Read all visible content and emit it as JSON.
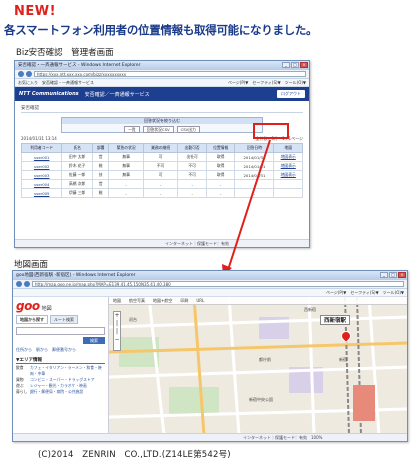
{
  "new_label": "NEW!",
  "headline": "各スマートフォン利用者の位置情報も取得可能になりました。",
  "caption_admin": "Biz安否確認　管理者画面",
  "caption_map": "地図画面",
  "footer": "(C)2014　ZENRIN　CO.,LTD.(Z14LE第542号)",
  "colors": {
    "new": "#e0201a",
    "headline": "#1a3a8a",
    "header_blue": "#1d3f8f",
    "highlight": "#e0201a"
  },
  "admin_window": {
    "title": "安否確認・一斉通報サービス - Windows Internet Explorer",
    "url": "https://xxx.ntt.xxx.xxx.com/bizz/xxxxxxxxxx",
    "toolbar_left": "お気に入り　安否確認・一斉通報サービス",
    "toolbar_right": "ページ(P)▼　セーフティ(S)▼　ツール(O)▼",
    "logo": "NTT Communications",
    "app_title": "安否確認／一斉通報サービス",
    "logout": "ログアウト",
    "section": "安否確認",
    "filter_header": "回答状況を絞り込む",
    "filter_buttons": [
      "一覧",
      "回答状況CSV",
      "CSV出力"
    ],
    "meta_left": "2014/01/31 13:14",
    "meta_right": "全件数：5件　1 / 1ページ",
    "columns": [
      "利用者コード",
      "氏名",
      "部署",
      "緊急の状況",
      "業務の継続",
      "出勤可否",
      "位置情報",
      "回答日時",
      "地図"
    ],
    "rows": [
      [
        "user001",
        "田中 太郎",
        "営",
        "無事",
        "可",
        "出社可",
        "取得",
        "2014/01/31",
        "地図表示"
      ],
      [
        "user002",
        "鈴木 花子",
        "総",
        "無事",
        "不可",
        "不可",
        "取得",
        "2014/01/31",
        "地図表示"
      ],
      [
        "user003",
        "佐藤 一郎",
        "技",
        "無事",
        "可",
        "不可",
        "取得",
        "2014/01/31",
        "地図表示"
      ],
      [
        "user004",
        "高橋 次郎",
        "営",
        "-",
        "-",
        "-",
        "-",
        "-",
        ""
      ],
      [
        "user005",
        "伊藤 三郎",
        "総",
        "-",
        "-",
        "-",
        "-",
        "-",
        ""
      ]
    ],
    "status": "インターネット｜保護モード：有効"
  },
  "map_window": {
    "title": "goo地図(西新宿駅 -新宿区) - Windows Internet Explorer",
    "url": "http://map.goo.ne.jp/map.php?MAP=E139.41.45.150N35.41.40.380",
    "toolbar_right": "ページ(P)▼　セーフティ(S)▼　ツール(O)▼",
    "logo": "goo",
    "logo_suffix": "地図",
    "tabs": [
      "地図から探す",
      "ルート検索"
    ],
    "search_button": "検索",
    "sub_links": "住所から　駅から　郵便番号から",
    "area_heading": "▼エリア情報",
    "area_list": [
      {
        "cat": "飲食",
        "links": "カフェ・イタリアン・ラーメン・和食・焼肉・中華"
      },
      {
        "cat": "買物",
        "links": "コンビニ・スーパー・ドラッグストア"
      },
      {
        "cat": "遊ぶ",
        "links": "レジャー・観光・カラオケ・映画"
      },
      {
        "cat": "暮らし",
        "links": "銀行・郵便局・病院・公共施設"
      }
    ],
    "map_tabs": [
      "地図",
      "航空写真",
      "地図+航空",
      "印刷",
      "URL"
    ],
    "station": "西新宿駅",
    "map_labels": [
      "新宿",
      "西新宿",
      "新宿中央公園",
      "都庁前",
      "初台"
    ],
    "status": "インターネット｜保護モード：有効　100%"
  }
}
